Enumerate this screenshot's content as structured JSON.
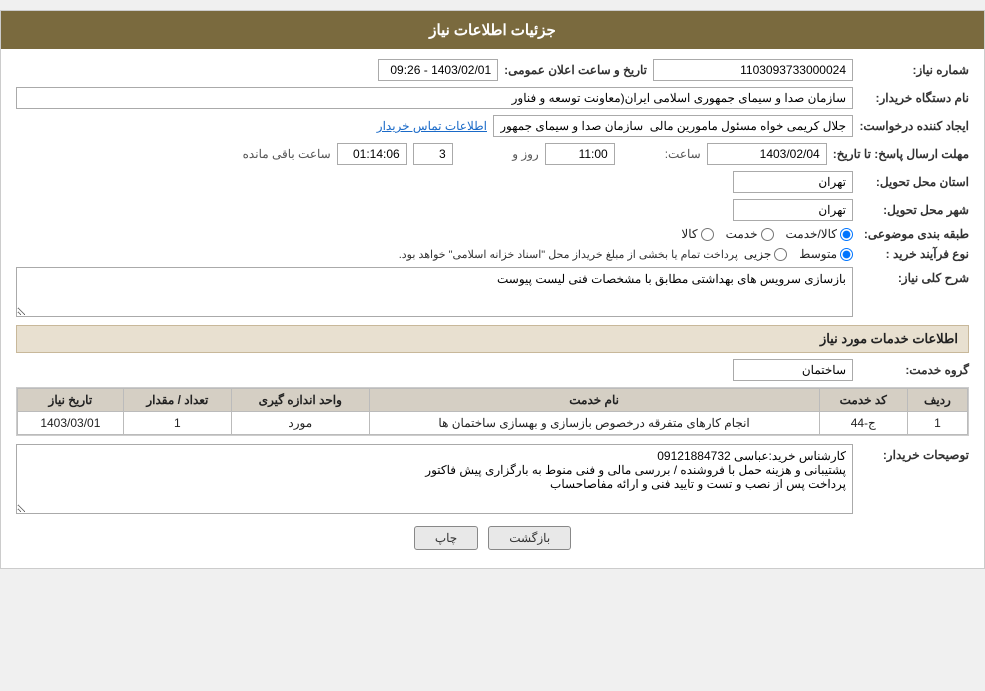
{
  "header": {
    "title": "جزئیات اطلاعات نیاز"
  },
  "fields": {
    "need_number_label": "شماره نیاز:",
    "need_number_value": "1103093733000024",
    "date_label": "تاریخ و ساعت اعلان عمومی:",
    "date_value": "1403/02/01 - 09:26",
    "buyer_label": "نام دستگاه خریدار:",
    "buyer_value": "سازمان صدا و سیمای جمهوری اسلامی ایران(معاونت توسعه و فناور",
    "creator_label": "ایجاد کننده درخواست:",
    "creator_value": "جلال کریمی خواه مسئول مامورین مالی  سازمان صدا و سیمای جمهوری اسلام",
    "creator_link": "اطلاعات تماس خریدار",
    "deadline_label": "مهلت ارسال پاسخ: تا تاریخ:",
    "deadline_date": "1403/02/04",
    "deadline_time_label": "ساعت:",
    "deadline_time": "11:00",
    "deadline_days_label": "روز و",
    "deadline_days": "3",
    "deadline_remaining_label": "ساعت باقی مانده",
    "deadline_remaining": "01:14:06",
    "province_label": "استان محل تحویل:",
    "province_value": "تهران",
    "city_label": "شهر محل تحویل:",
    "city_value": "تهران",
    "category_label": "طبقه بندی موضوعی:",
    "category_options": [
      "کالا",
      "خدمت",
      "کالا/خدمت"
    ],
    "category_selected": "کالا",
    "process_label": "نوع فرآیند خرید :",
    "process_options": [
      "جزیی",
      "متوسط"
    ],
    "process_note": "پرداخت تمام یا بخشی از مبلغ خریداز محل \"اسناد خزانه اسلامی\" خواهد بود.",
    "description_label": "شرح کلی نیاز:",
    "description_value": "بازسازی سرویس های بهداشتی مطابق با مشخصات فنی لیست پیوست"
  },
  "services_section": {
    "title": "اطلاعات خدمات مورد نیاز",
    "service_group_label": "گروه خدمت:",
    "service_group_value": "ساختمان",
    "table": {
      "headers": [
        "ردیف",
        "کد خدمت",
        "نام خدمت",
        "واحد اندازه گیری",
        "تعداد / مقدار",
        "تاریخ نیاز"
      ],
      "rows": [
        {
          "row": "1",
          "code": "ج-44",
          "name": "انجام کارهای متفرقه درخصوص بازسازی و بهسازی ساختمان ها",
          "unit": "مورد",
          "quantity": "1",
          "date": "1403/03/01"
        }
      ]
    }
  },
  "buyer_notes_label": "توصیحات خریدار:",
  "buyer_notes_value": "کارشناس خرید:عباسی 09121884732\nپشتیبانی و هزینه حمل با فروشنده / بررسی مالی و فنی منوط به بارگزاری پیش فاکتور\nپرداخت پس از نصب و تست و تایید فنی و ارائه مفاصاحساب",
  "buttons": {
    "back_label": "بازگشت",
    "print_label": "چاپ"
  }
}
